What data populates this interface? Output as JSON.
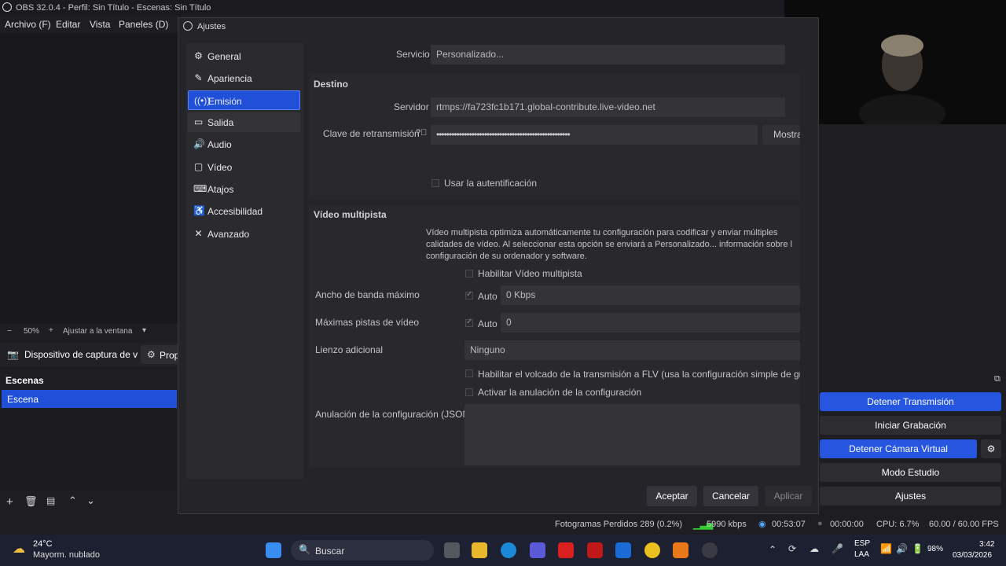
{
  "window": {
    "title": "OBS 32.0.4 - Perfil: Sin Título - Escenas: Sin Título"
  },
  "menu": [
    "Archivo (F)",
    "Editar",
    "Vista",
    "Paneles (D)"
  ],
  "zoom": {
    "minus": "−",
    "level": "50%",
    "plus": "+",
    "fit": "Ajustar a la ventana"
  },
  "sources": {
    "device": "Dispositivo de captura de v",
    "props": "Prop"
  },
  "scenes": {
    "header": "Escenas",
    "items": [
      "Escena"
    ]
  },
  "controls": {
    "stop_stream": "Detener Transmisión",
    "start_record": "Iniciar Grabación",
    "stop_vcam": "Detener Cámara Virtual",
    "studio": "Modo Estudio",
    "settings": "Ajustes"
  },
  "status": {
    "dropped": "Fotogramas Perdidos 289 (0.2%)",
    "kbps": "5990 kbps",
    "stream_time": "00:53:07",
    "rec_time": "00:00:00",
    "cpu": "CPU: 6.7%",
    "fps": "60.00 / 60.00 FPS"
  },
  "dialog": {
    "title": "Ajustes",
    "nav": [
      "General",
      "Apariencia",
      "Emisión",
      "Salida",
      "Audio",
      "Vídeo",
      "Atajos",
      "Accesibilidad",
      "Avanzado"
    ],
    "service_label": "Servicio",
    "service_value": "Personalizado...",
    "destino": "Destino",
    "server_label": "Servidor",
    "server_value": "rtmps://fa723fc1b171.global-contribute.live-video.net",
    "key_label": "Clave de retransmisión",
    "key_value": "•••••••••••••••••••••••••••••••••••••••••••••••••••••",
    "show_btn": "Mostra",
    "use_auth": "Usar la autentificación",
    "multitrack_title": "Vídeo multipista",
    "multitrack_desc": "Vídeo multipista optimiza automáticamente tu configuración para codificar y enviar múltiples calidades de vídeo. Al seleccionar esta opción se enviará a Personalizado... información sobre l configuración de su ordenador y software.",
    "enable_multitrack": "Habilitar Vídeo multipista",
    "max_bw_label": "Ancho de banda máximo",
    "auto": "Auto",
    "max_bw_value": "0 Kbps",
    "max_tracks_label": "Máximas pistas de vídeo",
    "max_tracks_value": "0",
    "extra_canvas_label": "Lienzo adicional",
    "extra_canvas_value": "Ninguno",
    "flv_dump": "Habilitar el volcado de la transmisión a FLV (usa la configuración simple de grabac",
    "config_override": "Activar la anulación de la configuración",
    "override_json_label": "Anulación de la configuración (JSON)",
    "accept": "Aceptar",
    "cancel": "Cancelar",
    "apply": "Aplicar"
  },
  "taskbar": {
    "weather_temp": "24°C",
    "weather_desc": "Mayorm. nublado",
    "search": "Buscar",
    "lang1": "ESP",
    "lang2": "LAA",
    "battery": "98%",
    "time": "3:42",
    "date": "03/03/2026"
  },
  "colors": {
    "accent": "#2050d8",
    "bg": "#242429"
  }
}
